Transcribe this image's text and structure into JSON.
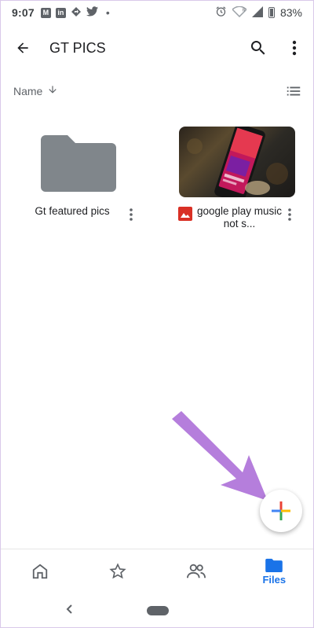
{
  "status_bar": {
    "time": "9:07",
    "battery_percent": "83%",
    "dot": "•"
  },
  "app_bar": {
    "title": "GT PICS"
  },
  "sort": {
    "label": "Name"
  },
  "items": [
    {
      "name": "Gt featured pics",
      "type": "folder"
    },
    {
      "name": "google play music not s...",
      "type": "image"
    }
  ],
  "bottom_nav": {
    "active_label": "Files"
  },
  "colors": {
    "folder": "#80868b",
    "accent": "#1a73e8",
    "arrow": "#b57edc",
    "image_icon": "#d93025"
  }
}
